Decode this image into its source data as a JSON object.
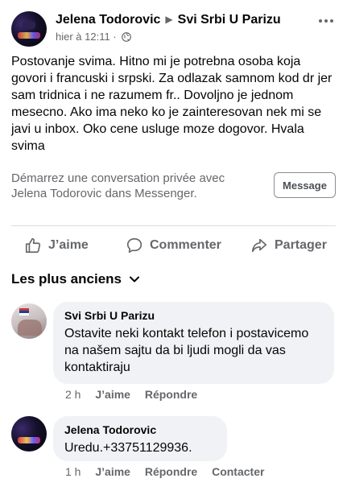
{
  "post": {
    "author": "Jelena Todorovic",
    "group": "Svi Srbi U Parizu",
    "timestamp": "hier à 12:11",
    "separator": "·",
    "privacy_icon": "globe-icon",
    "body": "Postovanje svima. Hitno mi je potrebna osoba koja govori i francuski i srpski. Za odlazak samnom kod dr jer sam tridnica i ne razumem fr.. Dovoljno je jednom mesecno. Ako ima neko ko je zainteresovan nek mi se javi u inbox. Oko cene usluge moze dogovor. Hvala svima"
  },
  "messenger_prompt": {
    "text": "Démarrez une conversation privée avec Jelena Todorovic dans Messenger.",
    "button_label": "Message"
  },
  "actions": {
    "like": "J’aime",
    "comment": "Commenter",
    "share": "Partager"
  },
  "sort": {
    "label": "Les plus anciens"
  },
  "comments": [
    {
      "author": "Svi Srbi U Parizu",
      "text": "Ostavite neki kontakt telefon i postavicemo na našem sajtu da bi ljudi mogli da vas kontaktiraju",
      "time": "2 h",
      "like": "J’aime",
      "reply": "Répondre"
    },
    {
      "author": "Jelena Todorovic",
      "text": "Uredu.+33751129936.",
      "time": "1 h",
      "like": "J’aime",
      "reply": "Répondre",
      "contact": "Contacter"
    }
  ],
  "colors": {
    "text_primary": "#050505",
    "text_secondary": "#65676b",
    "bubble_bg": "#f0f2f5",
    "divider": "#dadde1"
  }
}
